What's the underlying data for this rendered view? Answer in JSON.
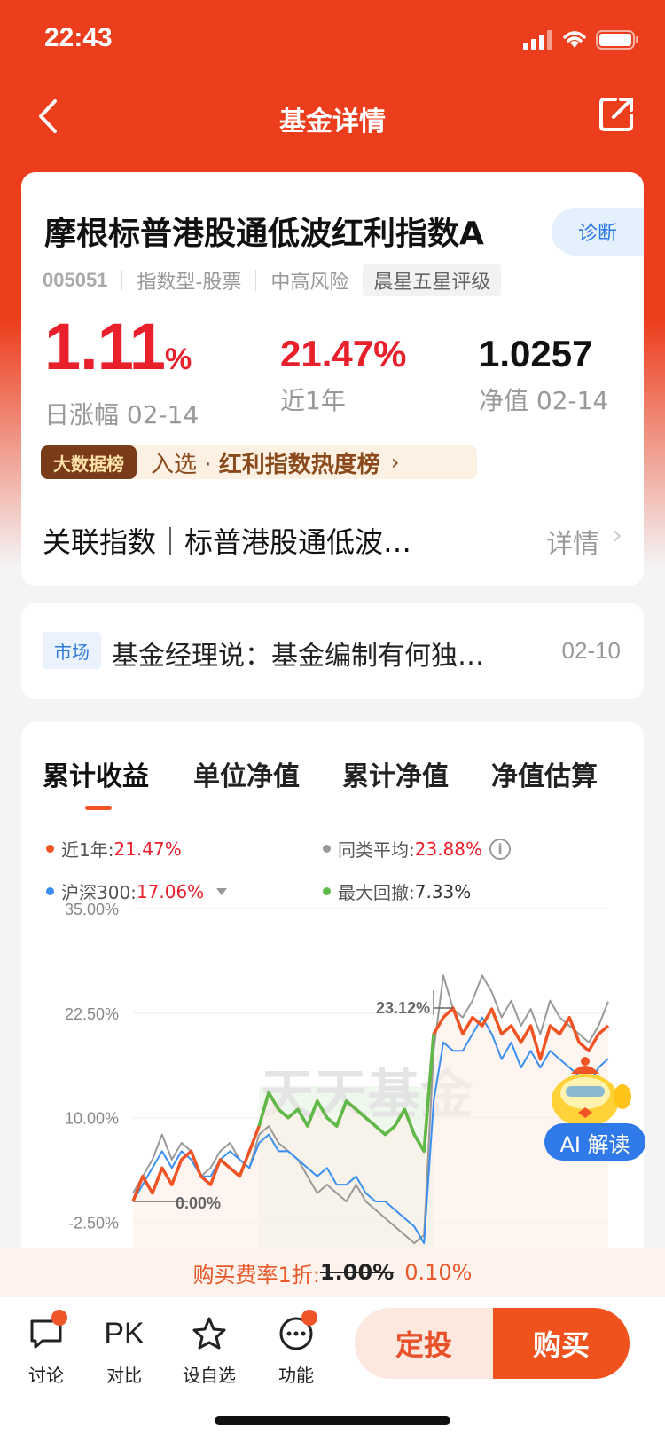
{
  "status": {
    "time": "22:43"
  },
  "nav": {
    "title": "基金详情",
    "back_icon": "chevron-left-icon",
    "share_icon": "share-icon"
  },
  "fund": {
    "name": "摩根标普港股通低波红利指数A",
    "diagnose_label": "诊断",
    "code": "005051",
    "type": "指数型-股票",
    "risk": "中高风险",
    "rating": "晨星五星评级",
    "day_change_value": "1.11",
    "day_change_unit": "%",
    "day_change_label": "日涨幅 02-14",
    "year_return": "21.47%",
    "year_return_label": "近1年",
    "nav_value": "1.0257",
    "nav_label": "净值 02-14"
  },
  "bigdata": {
    "badge": "大数据榜",
    "prefix": "入选 · ",
    "title": "红利指数热度榜",
    "arrow": "›"
  },
  "related_index": {
    "label": "关联指数｜标普港股通低波…",
    "detail": "详情",
    "chevron": "›"
  },
  "news": {
    "tag": "市场",
    "title": "基金经理说：基金编制有何独…",
    "date": "02-10"
  },
  "chart_tabs": [
    "累计收益",
    "单位净值",
    "累计净值",
    "净值估算"
  ],
  "legend": {
    "fund": {
      "label": "近1年: ",
      "value": "21.47%",
      "color": "#f05424"
    },
    "peer": {
      "label": "同类平均: ",
      "value": "23.88%",
      "color": "#999999"
    },
    "hs300": {
      "label": "沪深300: ",
      "value": "17.06%",
      "color": "#3b8ff0"
    },
    "drawdown": {
      "label": "最大回撤: ",
      "value": "7.33%",
      "color": "#5dbb4a"
    }
  },
  "chart_data": {
    "type": "line",
    "y_ticks": [
      "35.00%",
      "22.50%",
      "10.00%",
      "-2.50%"
    ],
    "ylim": [
      -7,
      35
    ],
    "annotations": {
      "start": "0.00%",
      "peak": "23.12%"
    },
    "watermark": "天天基金",
    "series": [
      {
        "name": "近1年",
        "color": "#f05424",
        "values": [
          0,
          3,
          1,
          4,
          2,
          5,
          6,
          3,
          2,
          5,
          4,
          3,
          6,
          9,
          13,
          11,
          10,
          11,
          9,
          12,
          10,
          9,
          12,
          11,
          10,
          9,
          8,
          9,
          11,
          8,
          6,
          20,
          22,
          23.12,
          20,
          22,
          21,
          23,
          20,
          21,
          19,
          21,
          17,
          21,
          20,
          22,
          19,
          18,
          20,
          21
        ]
      },
      {
        "name": "同类平均",
        "color": "#999999",
        "values": [
          1,
          3,
          5,
          8,
          5,
          7,
          6,
          3,
          4,
          6,
          7,
          5,
          4,
          8,
          9,
          7,
          6,
          5,
          3,
          1,
          2,
          1,
          0,
          2,
          0,
          -1,
          -2,
          -3,
          -4,
          -5,
          -4,
          18,
          27,
          23,
          22,
          24,
          27,
          25,
          22,
          24,
          21,
          23,
          20,
          24,
          22,
          21,
          20,
          19,
          21,
          23.88
        ]
      },
      {
        "name": "沪深300",
        "color": "#3b8ff0",
        "values": [
          0,
          2,
          4,
          6,
          4,
          6,
          5,
          3,
          3,
          5,
          6,
          5,
          4,
          7,
          8,
          6,
          6,
          5,
          4,
          3,
          4,
          2,
          2,
          3,
          1,
          0,
          0,
          -1,
          -2,
          -3,
          -5,
          12,
          19,
          18,
          18,
          20,
          22,
          20,
          17,
          19,
          16,
          18,
          16,
          18,
          17,
          16,
          15,
          14,
          16,
          17.06
        ]
      }
    ]
  },
  "fee": {
    "prefix": "购买费率1折: ",
    "old_rate": "1.00%",
    "new_rate": "0.10%"
  },
  "ai": {
    "label": "AI 解读"
  },
  "bottom": {
    "discuss": "讨论",
    "compare_glyph": "PK",
    "compare": "对比",
    "watchlist": "设自选",
    "functions": "功能",
    "sip": "定投",
    "buy": "购买"
  }
}
